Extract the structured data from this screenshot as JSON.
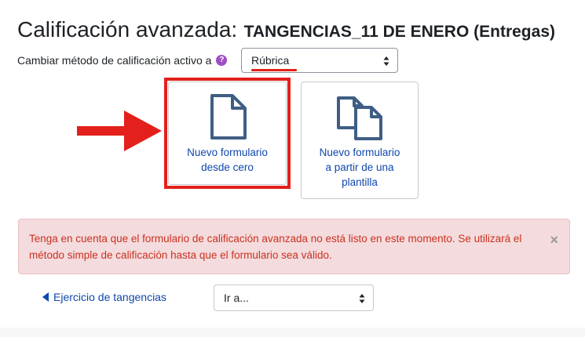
{
  "header": {
    "title": "Calificación avanzada:",
    "subtitle": "TANGENCIAS_11 DE ENERO (Entregas)"
  },
  "method": {
    "label": "Cambiar método de calificación activo a",
    "help_symbol": "?",
    "selected": "Rúbrica"
  },
  "cards": {
    "new_form": {
      "label_line1": "Nuevo formulario",
      "label_line2": "desde cero"
    },
    "from_template": {
      "label_line1": "Nuevo formulario",
      "label_line2": "a partir de una",
      "label_line3": "plantilla"
    }
  },
  "alert": {
    "text": "Tenga en cuenta que el formulario de calificación avanzada no está listo en este momento. Se utilizará el método simple de calificación hasta que el formulario sea válido.",
    "close_symbol": "×"
  },
  "navigation": {
    "back_link": "Ejercicio de tangencias",
    "jump_placeholder": "Ir a..."
  },
  "colors": {
    "link": "#0f47ad",
    "highlight": "#e3201b",
    "alert_text": "#ca3120",
    "alert_bg": "#f4dbdd",
    "help_icon": "#a04ec3"
  }
}
